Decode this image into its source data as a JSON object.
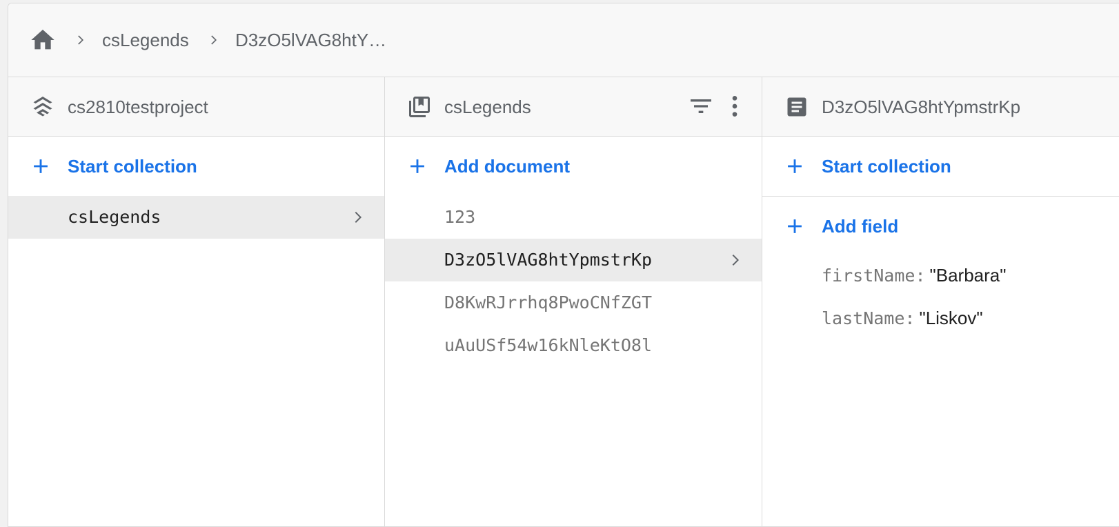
{
  "breadcrumb": {
    "icon": "home-icon",
    "items": [
      "csLegends",
      "D3zO5lVAG8htY…"
    ]
  },
  "columns": {
    "project": {
      "icon": "stack-icon",
      "title": "cs2810testproject",
      "add_label": "Start collection",
      "items": [
        {
          "label": "csLegends",
          "selected": true
        }
      ]
    },
    "collection": {
      "icon": "collection-icon",
      "title": "csLegends",
      "add_label": "Add document",
      "actions": [
        "filter-icon",
        "more-vert-icon"
      ],
      "items": [
        {
          "label": "123",
          "selected": false
        },
        {
          "label": "D3zO5lVAG8htYpmstrKp",
          "selected": true
        },
        {
          "label": "D8KwRJrrhq8PwoCNfZGT",
          "selected": false
        },
        {
          "label": "uAuUSf54w16kNleKtO8l",
          "selected": false
        }
      ]
    },
    "document": {
      "icon": "document-icon",
      "title": "D3zO5lVAG8htYpmstrKp",
      "add_collection_label": "Start collection",
      "add_field_label": "Add field",
      "fields": [
        {
          "key": "firstName:",
          "value": "\"Barbara\""
        },
        {
          "key": "lastName:",
          "value": "\"Liskov\""
        }
      ]
    }
  },
  "colors": {
    "accent": "#1a73e8",
    "muted_text": "#5f6368",
    "selected_bg": "#ebebeb"
  }
}
